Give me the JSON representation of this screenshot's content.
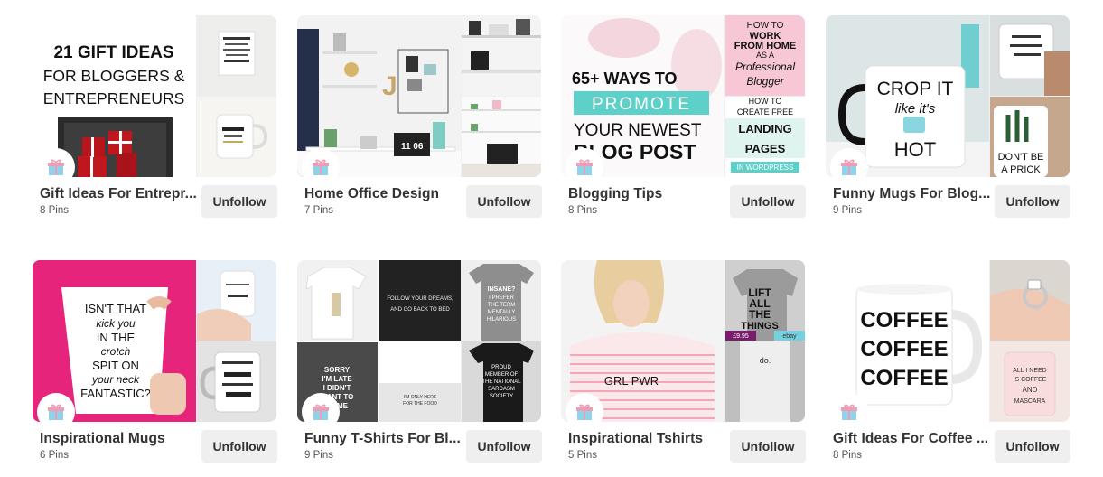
{
  "button_label": "Unfollow",
  "boards": [
    {
      "title": "Gift Ideas For Entrepr...",
      "pins": "8 Pins",
      "cover_text": [
        "21 GIFT IDEAS",
        "FOR BLOGGERS &",
        "ENTREPRENEURS"
      ]
    },
    {
      "title": "Home Office Design",
      "pins": "7 Pins",
      "cover_text": [
        "11 06"
      ]
    },
    {
      "title": "Blogging Tips",
      "pins": "8 Pins",
      "cover_text": [
        "65+ WAYS TO",
        "PROMOTE",
        "YOUR NEWEST",
        "BLOG POST"
      ],
      "side_text": [
        "HOW TO",
        "WORK",
        "FROM HOME",
        "AS A",
        "Professional",
        "Blogger",
        "HOW TO",
        "CREATE FREE",
        "LANDING",
        "PAGES",
        "IN WORDPRESS"
      ]
    },
    {
      "title": "Funny Mugs For Blog...",
      "pins": "9 Pins",
      "cover_text": [
        "CROP IT",
        "like it's",
        "HOT"
      ],
      "side_text": [
        "DON'T BE",
        "A PRICK"
      ]
    },
    {
      "title": "Inspirational Mugs",
      "pins": "6 Pins",
      "cover_text": [
        "ISN'T THAT",
        "kick you",
        "IN THE",
        "crotch",
        "SPIT ON",
        "your neck",
        "FANTASTIC?"
      ]
    },
    {
      "title": "Funny T-Shirts For Bl...",
      "pins": "9 Pins",
      "cover_text": [
        "FOLLOW YOUR DREAMS,",
        "AND GO BACK TO BED",
        "SORRY",
        "I'M LATE",
        "I DIDN'T",
        "WANT TO",
        "COME",
        "INSANE?",
        "I PREFER",
        "THE TERM",
        "MENTALLY",
        "HILARIOUS",
        "PROUD",
        "MEMBER OF",
        "THE NATIONAL",
        "SARCASM",
        "SOCIETY",
        "I'M ONLY HERE",
        "FOR THE FOOD"
      ]
    },
    {
      "title": "Inspirational Tshirts",
      "pins": "5 Pins",
      "cover_text": [
        "GRL PWR"
      ],
      "side_text": [
        "LIFT",
        "ALL",
        "THE",
        "THINGS",
        "£9.95",
        "ebay",
        "do."
      ]
    },
    {
      "title": "Gift Ideas For Coffee ...",
      "pins": "8 Pins",
      "cover_text": [
        "COFFEE",
        "COFFEE",
        "COFFEE"
      ],
      "side_text": [
        "ALL I NEED",
        "IS COFFEE",
        "AND",
        "MASCARA"
      ]
    }
  ]
}
